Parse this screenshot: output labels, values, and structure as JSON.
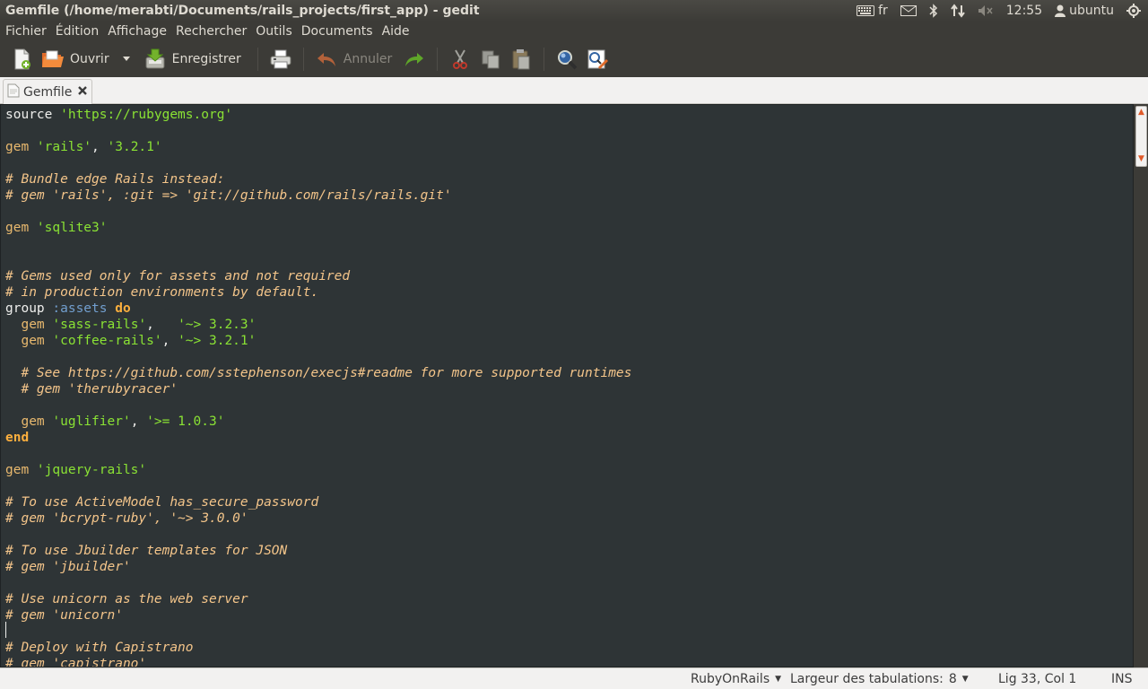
{
  "window": {
    "title": "Gemfile (/home/merabti/Documents/rails_projects/first_app) - gedit"
  },
  "indicators": {
    "keyboard": "fr",
    "clock": "12:55",
    "user": "ubuntu"
  },
  "menu": [
    "Fichier",
    "Édition",
    "Affichage",
    "Rechercher",
    "Outils",
    "Documents",
    "Aide"
  ],
  "toolbar": {
    "open_label": "Ouvrir",
    "save_label": "Enregistrer",
    "undo_label": "Annuler"
  },
  "tab": {
    "label": "Gemfile"
  },
  "code": [
    [
      [
        "pl",
        "source "
      ],
      [
        "st",
        "'https://rubygems.org'"
      ]
    ],
    [],
    [
      [
        "kw",
        "gem "
      ],
      [
        "st",
        "'rails'"
      ],
      [
        "pl",
        ", "
      ],
      [
        "st",
        "'3.2.1'"
      ]
    ],
    [],
    [
      [
        "cm",
        "# Bundle edge Rails instead:"
      ]
    ],
    [
      [
        "cm",
        "# gem 'rails', :git => 'git://github.com/rails/rails.git'"
      ]
    ],
    [],
    [
      [
        "kw",
        "gem "
      ],
      [
        "st",
        "'sqlite3'"
      ]
    ],
    [],
    [],
    [
      [
        "cm",
        "# Gems used only for assets and not required"
      ]
    ],
    [
      [
        "cm",
        "# in production environments by default."
      ]
    ],
    [
      [
        "pl",
        "group "
      ],
      [
        "sym",
        ":assets "
      ],
      [
        "kwb",
        "do"
      ]
    ],
    [
      [
        "pl",
        "  "
      ],
      [
        "kw",
        "gem "
      ],
      [
        "st",
        "'sass-rails'"
      ],
      [
        "pl",
        ",   "
      ],
      [
        "st",
        "'~> 3.2.3'"
      ]
    ],
    [
      [
        "pl",
        "  "
      ],
      [
        "kw",
        "gem "
      ],
      [
        "st",
        "'coffee-rails'"
      ],
      [
        "pl",
        ", "
      ],
      [
        "st",
        "'~> 3.2.1'"
      ]
    ],
    [],
    [
      [
        "pl",
        "  "
      ],
      [
        "cm",
        "# See https://github.com/sstephenson/execjs#readme for more supported runtimes"
      ]
    ],
    [
      [
        "pl",
        "  "
      ],
      [
        "cm",
        "# gem 'therubyracer'"
      ]
    ],
    [],
    [
      [
        "pl",
        "  "
      ],
      [
        "kw",
        "gem "
      ],
      [
        "st",
        "'uglifier'"
      ],
      [
        "pl",
        ", "
      ],
      [
        "st",
        "'>= 1.0.3'"
      ]
    ],
    [
      [
        "kwb",
        "end"
      ]
    ],
    [],
    [
      [
        "kw",
        "gem "
      ],
      [
        "st",
        "'jquery-rails'"
      ]
    ],
    [],
    [
      [
        "cm",
        "# To use ActiveModel has_secure_password"
      ]
    ],
    [
      [
        "cm",
        "# gem 'bcrypt-ruby', '~> 3.0.0'"
      ]
    ],
    [],
    [
      [
        "cm",
        "# To use Jbuilder templates for JSON"
      ]
    ],
    [
      [
        "cm",
        "# gem 'jbuilder'"
      ]
    ],
    [],
    [
      [
        "cm",
        "# Use unicorn as the web server"
      ]
    ],
    [
      [
        "cm",
        "# gem 'unicorn'"
      ]
    ],
    [],
    [
      [
        "cm",
        "# Deploy with Capistrano"
      ]
    ],
    [
      [
        "cm",
        "# gem 'capistrano'"
      ]
    ]
  ],
  "status": {
    "language": "RubyOnRails",
    "tab_width_label": "Largeur des tabulations:",
    "tab_width": "8",
    "position": "Lig 33, Col 1",
    "mode": "INS"
  },
  "colors": {
    "editor_bg": "#2e3436",
    "string": "#8ae234",
    "keyword": "#e9b96e",
    "comment": "#f4c58a",
    "symbol": "#729fcf"
  }
}
